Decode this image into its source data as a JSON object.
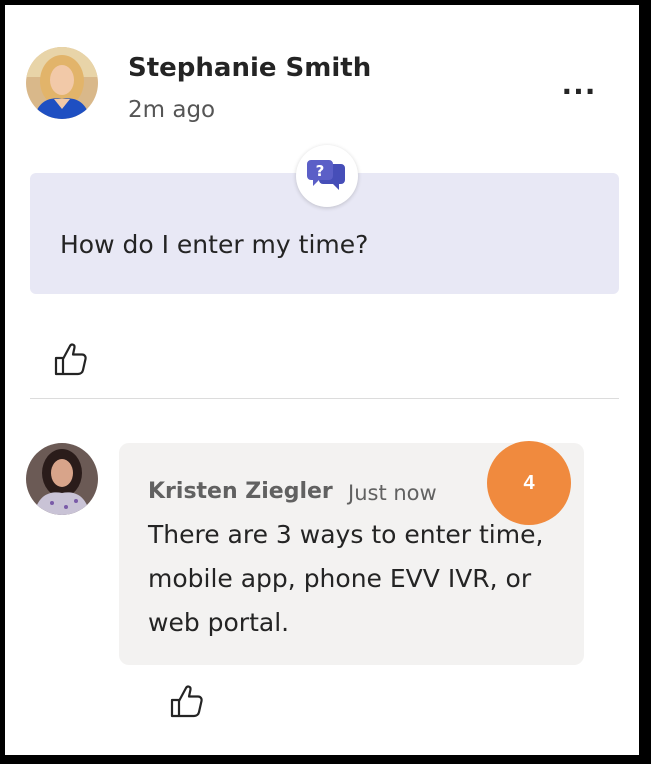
{
  "post": {
    "author": "Stephanie Smith",
    "time": "2m ago",
    "more_label": "...",
    "question": "How do I enter my time?"
  },
  "reply": {
    "author": "Kristen Ziegler",
    "time": "Just now",
    "text": "There are 3 ways to enter time, mobile app, phone EVV IVR, or web portal."
  },
  "step_badge": "4",
  "colors": {
    "question_bg": "#e8e8f5",
    "reply_bg": "#f3f2f1",
    "badge_orange": "#f08a3e",
    "icon_purple": "#5b5fc7"
  }
}
